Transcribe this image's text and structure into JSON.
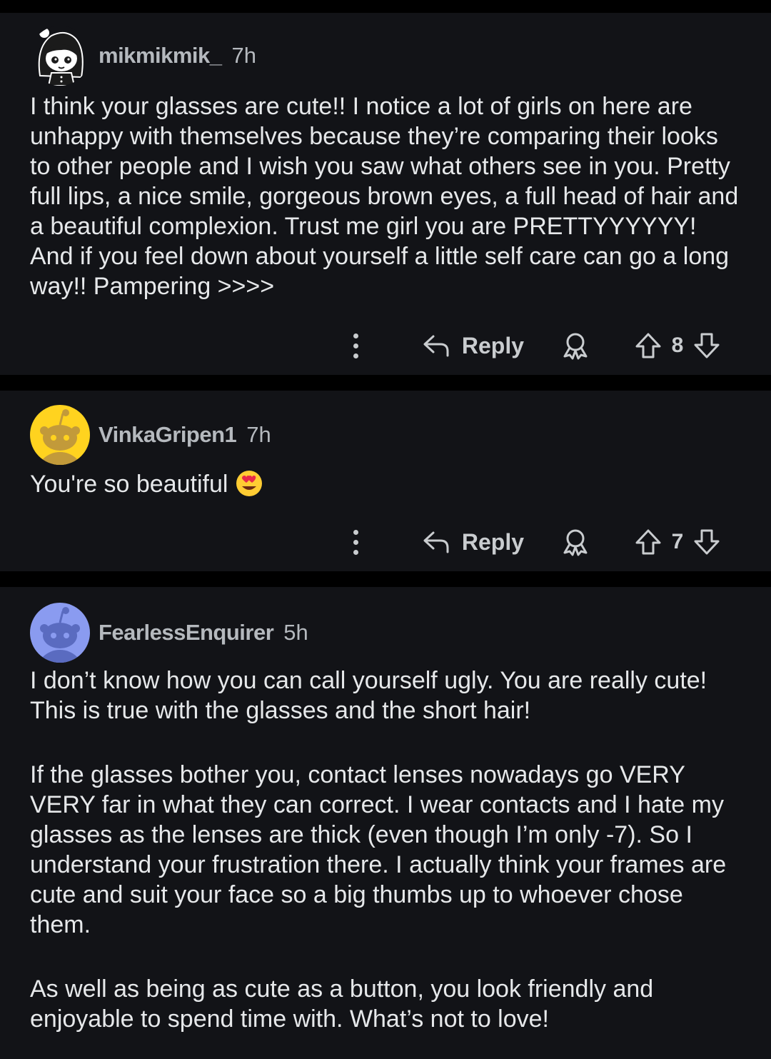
{
  "comments": [
    {
      "username": "mikmikmik_",
      "time": "7h",
      "paragraphs": [
        "I think your glasses are cute!! I notice a lot of girls on here are unhappy with themselves because they’re comparing their looks to other people and I wish you saw what others see in you. Pretty full lips, a nice smile, gorgeous brown eyes, a full head of hair and a beautiful complexion. Trust me girl you are PRETTYYYYYY! And if you feel down about yourself a little self care can go a long way!! Pampering >>>>"
      ],
      "reply_label": "Reply",
      "score": "8"
    },
    {
      "username": "VinkaGripen1",
      "time": "7h",
      "paragraphs": [
        "You're so beautiful"
      ],
      "emoji": "heart-eyes-emoji",
      "reply_label": "Reply",
      "score": "7"
    },
    {
      "username": "FearlessEnquirer",
      "time": "5h",
      "paragraphs": [
        "I don’t know how you can call yourself ugly. You are really cute! This is true with the glasses and the short hair!",
        "If the glasses bother you, contact lenses nowadays go VERY VERY far in what they can correct. I wear contacts and I hate my glasses as the lenses are thick (even though I’m only -7). So I understand your frustration there. I actually think your frames are cute and suit your face so a big thumbs up to whoever chose them.",
        "As well as being as cute as a button, you look friendly and enjoyable to spend time with. What’s not to love!"
      ]
    }
  ],
  "icons": [
    "more-options-icon",
    "reply-arrow-icon",
    "award-icon",
    "upvote-icon",
    "downvote-icon"
  ],
  "colors": {
    "background": "#000000",
    "card": "#121317",
    "text": "#e6e8ea",
    "muted": "#b5b9be",
    "avatar_yellow": "#ffd31f",
    "avatar_blue": "#8a9bf0"
  }
}
